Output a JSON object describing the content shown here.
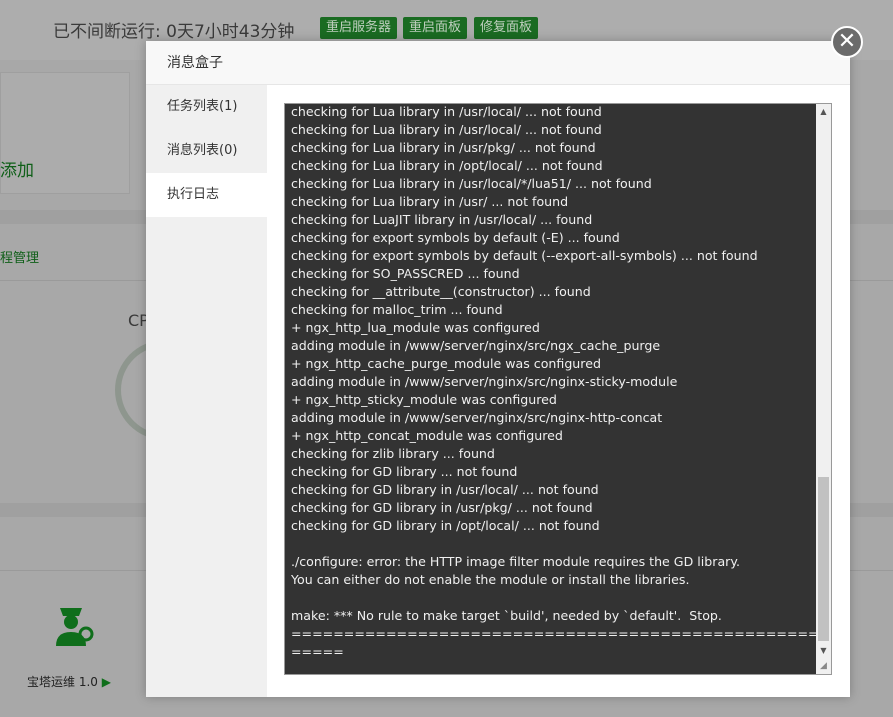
{
  "background": {
    "uptime_text": "已不间断运行: 0天7小时43分钟",
    "buttons": [
      "重启服务器",
      "重启面板",
      "修复面板"
    ],
    "add_label": "添加",
    "manage_label": "程管理",
    "cpu_label": "CP",
    "plugin_name": "宝塔运维",
    "plugin_version": "1.0"
  },
  "modal": {
    "title": "消息盒子",
    "tabs": [
      "任务列表(1)",
      "消息列表(0)",
      "执行日志"
    ],
    "active_tab": "执行日志",
    "log_lines": [
      "checking for Lua library in /usr/local/ ... not found",
      "checking for Lua library in /usr/local/ ... not found",
      "checking for Lua library in /usr/pkg/ ... not found",
      "checking for Lua library in /opt/local/ ... not found",
      "checking for Lua library in /usr/local/*/lua51/ ... not found",
      "checking for Lua library in /usr/ ... not found",
      "checking for LuaJIT library in /usr/local/ ... found",
      "checking for export symbols by default (-E) ... found",
      "checking for export symbols by default (--export-all-symbols) ... not found",
      "checking for SO_PASSCRED ... found",
      "checking for __attribute__(constructor) ... found",
      "checking for malloc_trim ... found",
      "+ ngx_http_lua_module was configured",
      "adding module in /www/server/nginx/src/ngx_cache_purge",
      "+ ngx_http_cache_purge_module was configured",
      "adding module in /www/server/nginx/src/nginx-sticky-module",
      "+ ngx_http_sticky_module was configured",
      "adding module in /www/server/nginx/src/nginx-http-concat",
      "+ ngx_http_concat_module was configured",
      "checking for zlib library ... found",
      "checking for GD library ... not found",
      "checking for GD library in /usr/local/ ... not found",
      "checking for GD library in /usr/pkg/ ... not found",
      "checking for GD library in /opt/local/ ... not found",
      "",
      "./configure: error: the HTTP image filter module requires the GD library.",
      "You can either do not enable the module or install the libraries.",
      "",
      "make: *** No rule to make target `build', needed by `default'.  Stop.",
      "==================================================",
      "====="
    ]
  }
}
